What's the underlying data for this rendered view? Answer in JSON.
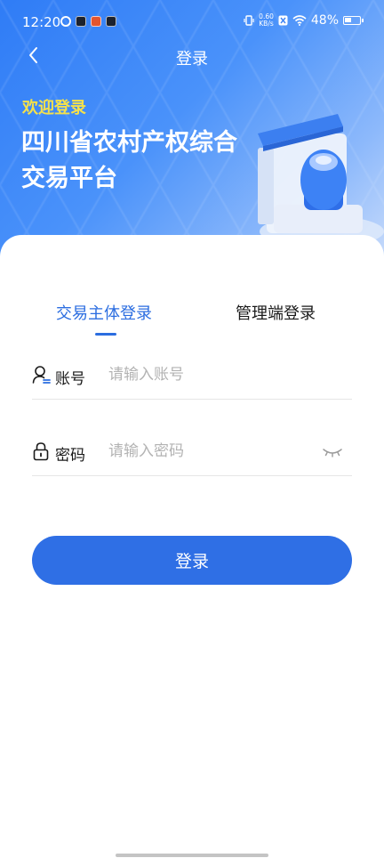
{
  "status_bar": {
    "time": "12:20",
    "speed_value": "0.60",
    "speed_unit": "KB/s",
    "battery": "48%",
    "battery_level": 0.48
  },
  "nav": {
    "title": "登录",
    "back_icon": "chevron-left-icon"
  },
  "hero": {
    "welcome": "欢迎登录",
    "platform_line1": "四川省农村产权综合",
    "platform_line2": "交易平台"
  },
  "tabs": [
    {
      "label": "交易主体登录",
      "active": true
    },
    {
      "label": "管理端登录",
      "active": false
    }
  ],
  "form": {
    "account_label": "账号",
    "account_placeholder": "请输入账号",
    "account_value": "",
    "password_label": "密码",
    "password_placeholder": "请输入密码",
    "password_value": "",
    "submit_label": "登录"
  },
  "colors": {
    "accent": "#2f6fe5",
    "welcome": "#f5e14a"
  }
}
